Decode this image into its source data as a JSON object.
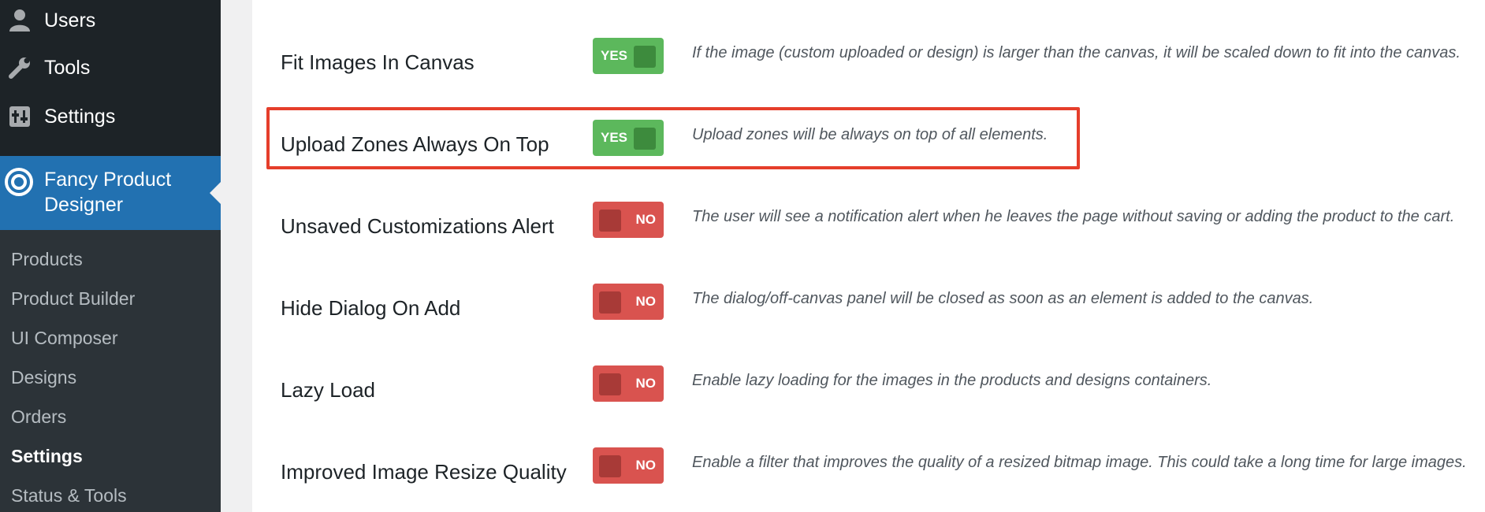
{
  "sidebar": {
    "top_items": [
      {
        "label": "Users",
        "icon": "users-icon"
      },
      {
        "label": "Tools",
        "icon": "wrench-icon"
      },
      {
        "label": "Settings",
        "icon": "settings-sliders-icon"
      }
    ],
    "active_item": {
      "label": "Fancy Product Designer",
      "icon": "fpd-logo-icon"
    },
    "submenu": [
      {
        "label": "Products",
        "current": false
      },
      {
        "label": "Product Builder",
        "current": false
      },
      {
        "label": "UI Composer",
        "current": false
      },
      {
        "label": "Designs",
        "current": false
      },
      {
        "label": "Orders",
        "current": false
      },
      {
        "label": "Settings",
        "current": true
      },
      {
        "label": "Status & Tools",
        "current": false
      }
    ]
  },
  "settings_rows": [
    {
      "title": "Fit Images In Canvas",
      "state": "YES",
      "description": "If the image (custom uploaded or design) is larger than the canvas, it will be scaled down to fit into the canvas."
    },
    {
      "title": "Upload Zones Always On Top",
      "state": "YES",
      "description": "Upload zones will be always on top of all elements."
    },
    {
      "title": "Unsaved Customizations Alert",
      "state": "NO",
      "description": "The user will see a notification alert when he leaves the page without saving or adding the product to the cart."
    },
    {
      "title": "Hide Dialog On Add",
      "state": "NO",
      "description": "The dialog/off-canvas panel will be closed as soon as an element is added to the canvas."
    },
    {
      "title": "Lazy Load",
      "state": "NO",
      "description": "Enable lazy loading for the images in the products and designs containers."
    },
    {
      "title": "Improved Image Resize Quality",
      "state": "NO",
      "description": "Enable a filter that improves the quality of a resized bitmap image. This could take a long time for large images."
    }
  ],
  "colors": {
    "sidebar_bg": "#1d2327",
    "submenu_bg": "#2c3338",
    "active_bg": "#2271b1",
    "toggle_yes": "#5cb85c",
    "toggle_no": "#d9534f",
    "highlight": "#e53e2b"
  }
}
